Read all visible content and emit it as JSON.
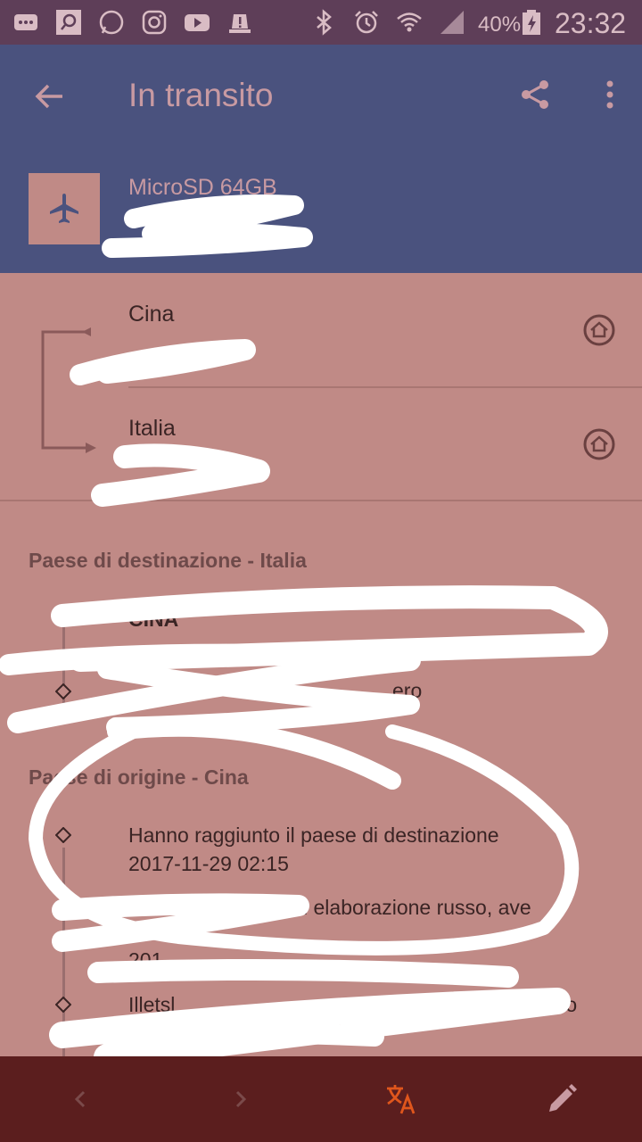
{
  "status_bar": {
    "battery": "40%",
    "time": "23:32",
    "icons": [
      "notification-icon",
      "search-app-icon",
      "whatsapp-icon",
      "instagram-icon",
      "youtube-icon",
      "alert-icon",
      "bluetooth-icon",
      "alarm-icon",
      "wifi-icon",
      "signal-icon",
      "battery-icon"
    ]
  },
  "app_bar": {
    "title": "In transito",
    "item_name": "MicroSD 64GB"
  },
  "route": {
    "origin": "Cina",
    "destination": "Italia"
  },
  "destination_section": {
    "title": "Paese di destinazione - Italia",
    "events": [
      {
        "text": "CINA"
      },
      {
        "text": "ero"
      }
    ]
  },
  "origin_section": {
    "title": "Paese di origine - Cina",
    "events": [
      {
        "text": "Hanno raggiunto il paese di destinazione",
        "time": "2017-11-29 02:15"
      },
      {
        "text": "i elaborazione russo, ave",
        "time": "201"
      },
      {
        "text": "Illetsl",
        "tail": "to"
      }
    ]
  },
  "colors": {
    "background": "#c08a86",
    "app_bar": "#4a527e",
    "status_bar": "#5e3e58",
    "bottom_bar": "#5b1e1e",
    "accent": "#e0561c"
  }
}
